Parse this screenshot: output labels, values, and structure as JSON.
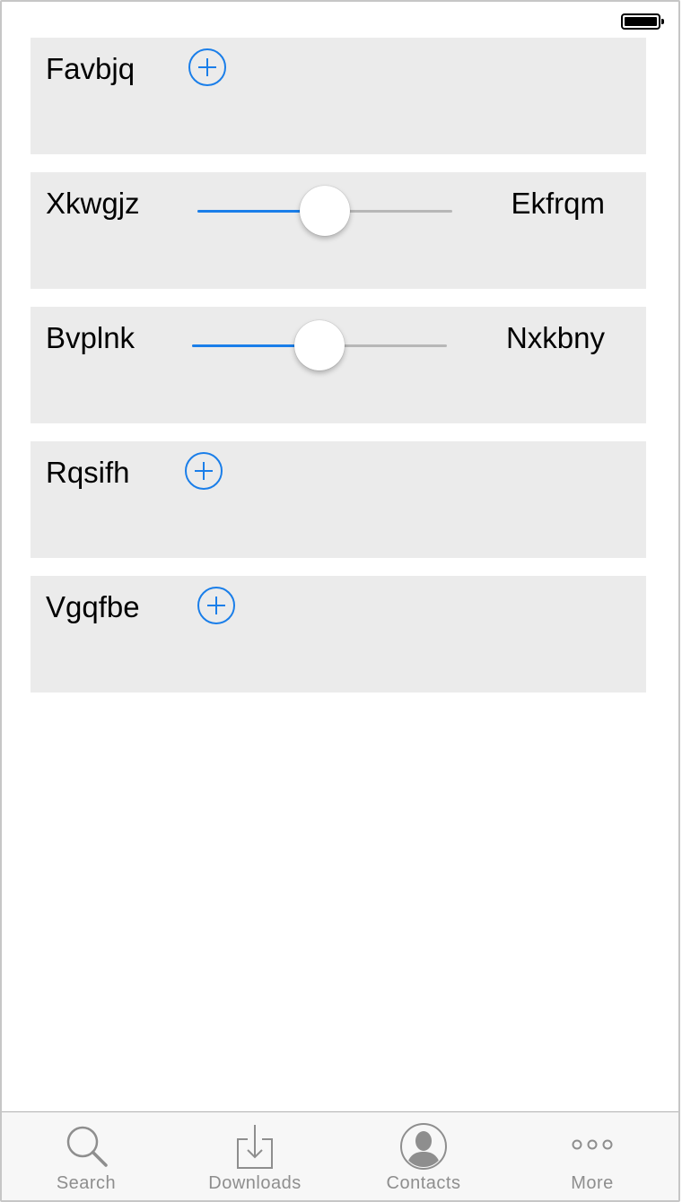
{
  "status_bar": {
    "battery_level": 1.0
  },
  "cards": [
    {
      "type": "add",
      "title": "Favbjq"
    },
    {
      "type": "slider",
      "left_label": "Xkwgjz",
      "right_label": "Ekfrqm",
      "value": 0.5
    },
    {
      "type": "slider",
      "left_label": "Bvplnk",
      "right_label": "Nxkbny",
      "value": 0.5
    },
    {
      "type": "add",
      "title": "Rqsifh"
    },
    {
      "type": "add",
      "title": "Vgqfbe"
    }
  ],
  "tab_bar": {
    "tabs": [
      {
        "label": "Search",
        "icon": "search-icon"
      },
      {
        "label": "Downloads",
        "icon": "download-icon"
      },
      {
        "label": "Contacts",
        "icon": "contact-icon"
      },
      {
        "label": "More",
        "icon": "more-icon"
      }
    ]
  },
  "colors": {
    "accent": "#1a7ee9",
    "card_background": "#ebebeb",
    "tab_inactive": "#8e8e8e"
  }
}
